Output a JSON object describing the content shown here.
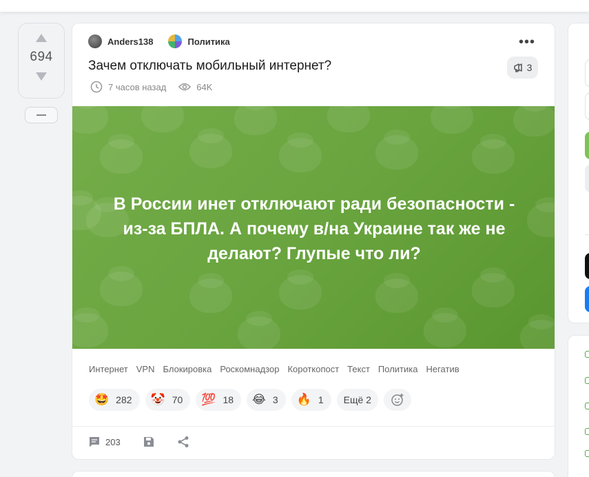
{
  "post": {
    "rating": "694",
    "author": "Anders138",
    "category": "Политика",
    "title": "Зачем отключать мобильный интернет?",
    "comment_badge_count": "3",
    "time_ago": "7 часов назад",
    "views": "64K",
    "banner_text": "В России инет отключают ради безопасности - из-за БПЛА. А почему в/на Украине так же не делают? Глупые что ли?",
    "banner_color": "#6aa540",
    "more_menu": "•••"
  },
  "tags": [
    "Интернет",
    "VPN",
    "Блокировка",
    "Роскомнадзор",
    "Короткопост",
    "Текст",
    "Политика",
    "Негатив"
  ],
  "reactions": [
    {
      "emoji": "🤩",
      "count": "282",
      "name": "star-struck-icon"
    },
    {
      "emoji": "🤡",
      "count": "70",
      "name": "clown-icon"
    },
    {
      "emoji": "💯",
      "count": "18",
      "name": "hundred-icon"
    },
    {
      "emoji": "😂",
      "count": "3",
      "name": "laughing-icon"
    },
    {
      "emoji": "🔥",
      "count": "1",
      "name": "fire-icon"
    }
  ],
  "reactions_more": "Ещё 2",
  "footer": {
    "comments_count": "203"
  }
}
